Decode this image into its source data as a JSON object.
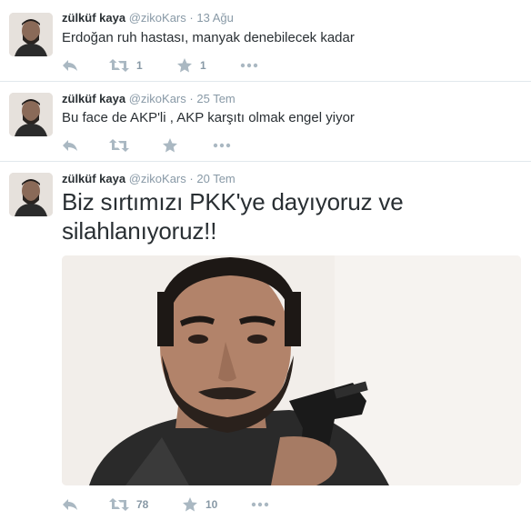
{
  "tweets": [
    {
      "fullname": "zülküf kaya",
      "username": "@zikoKars",
      "separator": "·",
      "time": "13 Ağu",
      "text": "Erdoğan ruh hastası, manyak denebilecek kadar",
      "retweets": "1",
      "favorites": "1"
    },
    {
      "fullname": "zülküf kaya",
      "username": "@zikoKars",
      "separator": "·",
      "time": "25 Tem",
      "text": "Bu face de AKP'li , AKP karşıtı olmak engel yiyor",
      "retweets": "",
      "favorites": ""
    },
    {
      "fullname": "zülküf kaya",
      "username": "@zikoKars",
      "separator": "·",
      "time": "20 Tem",
      "text": "Biz sırtımızı PKK'ye dayıyoruz ve silahlanıyoruz!!",
      "retweets": "78",
      "favorites": "10",
      "has_photo": true
    }
  ],
  "icons": {
    "reply": "reply-icon",
    "retweet": "retweet-icon",
    "favorite": "star-icon",
    "more": "more-icon"
  },
  "colors": {
    "action_gray": "#aab8c2",
    "text": "#292f33",
    "muted": "#8899a6"
  }
}
